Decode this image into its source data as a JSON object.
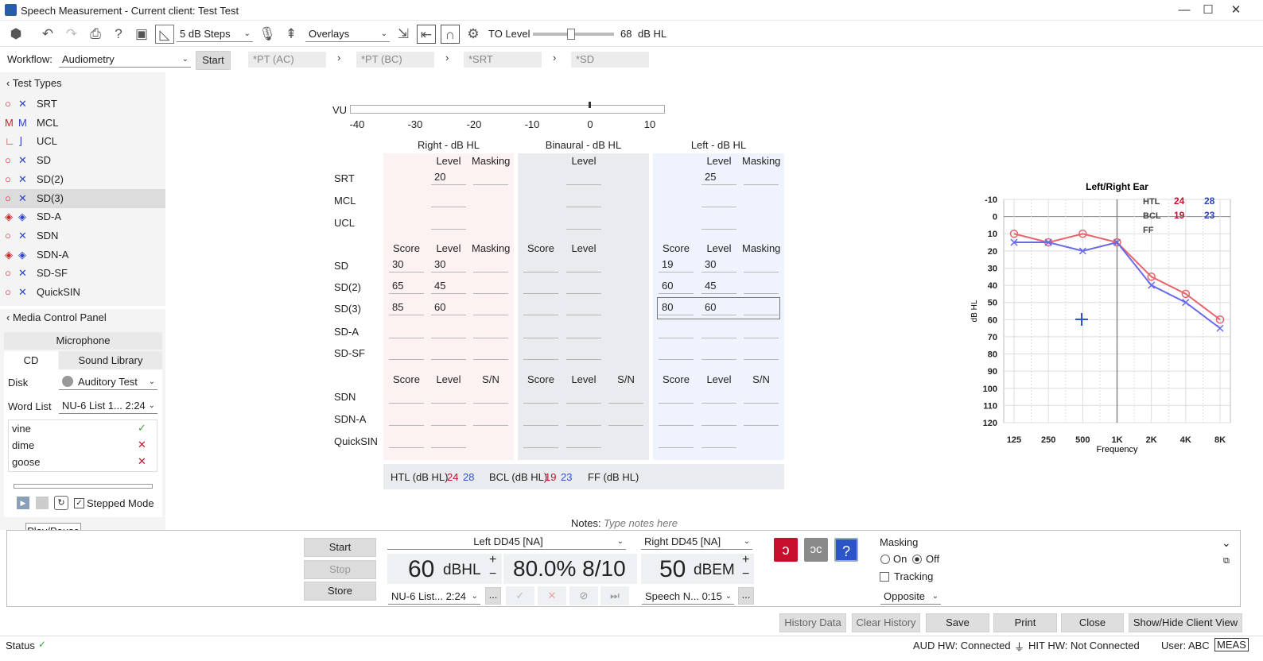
{
  "window": {
    "title": "Speech Measurement - Current client: Test Test",
    "minimize": "—",
    "maximize": "☐",
    "close": "✕"
  },
  "toolbar": {
    "steps": "5 dB Steps",
    "overlays": "Overlays",
    "to_label": "TO Level",
    "to_value": "68",
    "to_unit": "dB HL",
    "icons": [
      "layers-icon",
      "undo-icon",
      "redo-icon",
      "print-icon",
      "help-icon",
      "top-icon",
      "chart-icon",
      "mic-icon",
      "talkover-icon",
      "send-icon",
      "return-icon",
      "headphones-icon",
      "gear-icon"
    ]
  },
  "workflow": {
    "label": "Workflow:",
    "value": "Audiometry",
    "start": "Start",
    "steps": [
      "*PT (AC)",
      "*PT (BC)",
      "*SRT",
      "*SD"
    ]
  },
  "test_types": {
    "title": "Test Types",
    "items": [
      {
        "g1": "○",
        "g2": "✕",
        "label": "SRT"
      },
      {
        "g1": "M",
        "g2": "M",
        "label": "MCL"
      },
      {
        "g1": "∟",
        "g2": "⌋",
        "label": "UCL"
      },
      {
        "g1": "○",
        "g2": "✕",
        "label": "SD"
      },
      {
        "g1": "○",
        "g2": "✕",
        "label": "SD(2)"
      },
      {
        "g1": "○",
        "g2": "✕",
        "label": "SD(3)"
      },
      {
        "g1": "◈",
        "g2": "◈",
        "label": "SD-A"
      },
      {
        "g1": "○",
        "g2": "✕",
        "label": "SDN"
      },
      {
        "g1": "◈",
        "g2": "◈",
        "label": "SDN-A"
      },
      {
        "g1": "○",
        "g2": "✕",
        "label": "SD-SF"
      },
      {
        "g1": "○",
        "g2": "✕",
        "label": "QuickSIN"
      }
    ]
  },
  "media": {
    "title": "Media Control Panel",
    "microphone": "Microphone",
    "tab_cd": "CD",
    "tab_sound": "Sound Library",
    "disk_label": "Disk",
    "disk_value": "Auditory Test",
    "wordlist_label": "Word List",
    "wordlist_value": "NU-6 List 1...",
    "wordlist_time": "2:24",
    "words": [
      {
        "w": "vine",
        "m": "✓"
      },
      {
        "w": "dime",
        "m": "✕"
      },
      {
        "w": "goose",
        "m": "✕"
      }
    ],
    "stepped": "Stepped Mode",
    "tooltip": "Play/Pause"
  },
  "vu": {
    "label": "VU",
    "ticks": [
      "-40",
      "-30",
      "-20",
      "-10",
      "0",
      "10"
    ]
  },
  "table": {
    "right_title": "Right  - dB HL",
    "bin_title": "Binaural  - dB HL",
    "left_title": "Left  - dB HL",
    "rows1": [
      "SRT",
      "MCL",
      "UCL"
    ],
    "rows2": [
      "SD",
      "SD(2)",
      "SD(3)",
      "SD-A",
      "SD-SF"
    ],
    "rows3": [
      "SDN",
      "SDN-A",
      "QuickSIN"
    ],
    "level": "Level",
    "masking": "Masking",
    "score": "Score",
    "sn": "S/N",
    "right_srt": "20",
    "left_srt": "25",
    "right_sd": [
      "30",
      "30"
    ],
    "right_sd2": [
      "65",
      "45"
    ],
    "right_sd3": [
      "85",
      "60"
    ],
    "left_sd": [
      "19",
      "30"
    ],
    "left_sd2": [
      "60",
      "45"
    ],
    "left_sd3": [
      "80",
      "60"
    ],
    "htl_label": "HTL (dB HL)",
    "htl_r": "24",
    "htl_l": "28",
    "bcl_label": "BCL (dB HL)",
    "bcl_r": "19",
    "bcl_l": "23",
    "ff_label": "FF (dB HL)"
  },
  "chart_data": {
    "type": "line",
    "title": "Left/Right Ear",
    "xlabel": "Frequency",
    "ylabel": "dB HL",
    "x": [
      "125",
      "250",
      "500",
      "1K",
      "2K",
      "4K",
      "8K"
    ],
    "yticks": [
      "-10",
      "0",
      "10",
      "20",
      "30",
      "40",
      "50",
      "60",
      "70",
      "80",
      "90",
      "100",
      "110",
      "120"
    ],
    "ylim": [
      -10,
      120
    ],
    "legend": {
      "htl": "HTL",
      "bcl": "BCL",
      "ff": "FF",
      "htl_r": "24",
      "htl_l": "28",
      "bcl_r": "19",
      "bcl_l": "23"
    },
    "series": [
      {
        "values": [
          10,
          15,
          10,
          15,
          35,
          45,
          60
        ],
        "color": "#e8636a"
      },
      {
        "values": [
          15,
          15,
          20,
          15,
          40,
          50,
          65
        ],
        "color": "#6a6ae8"
      }
    ]
  },
  "notes": {
    "label": "Notes:",
    "placeholder": "Type notes here"
  },
  "control": {
    "start": "Start",
    "stop": "Stop",
    "store": "Store",
    "left_trans": "Left DD45 [NA]",
    "left_level": "60",
    "left_unit": "dBHL",
    "score": "80.0% 8/10",
    "right_trans": "Right DD45 [NA]",
    "right_level": "50",
    "right_unit": "dBEM",
    "list_left": "NU-6 List...",
    "time_left": "2:24",
    "list_right": "Speech N...",
    "time_right": "0:15",
    "masking": "Masking",
    "on": "On",
    "off": "Off",
    "tracking": "Tracking",
    "opposite": "Opposite",
    "plus": "+",
    "minus": "−",
    "more": "..."
  },
  "footer_buttons": [
    "History Data",
    "Clear History",
    "Save",
    "Print",
    "Close",
    "Show/Hide Client View"
  ],
  "status": {
    "label": "Status",
    "aud": "AUD HW: Connected",
    "hit": "HIT HW: Not Connected",
    "user": "User: ABC",
    "meas": "MEAS"
  }
}
